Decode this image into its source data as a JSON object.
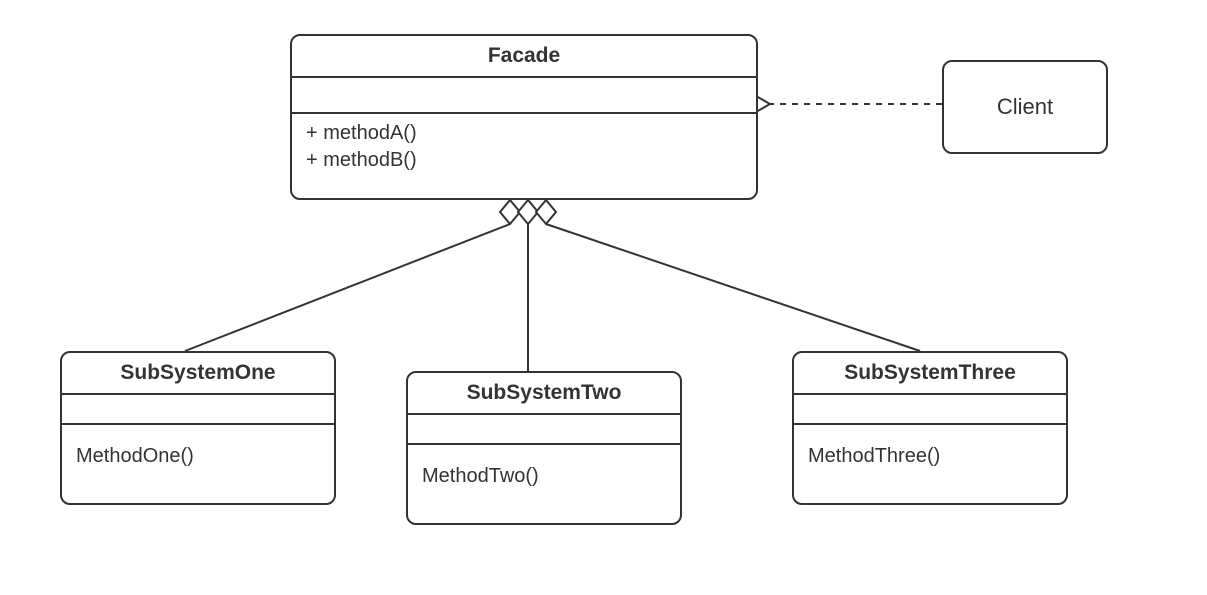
{
  "diagram": {
    "type": "uml-class-diagram",
    "pattern": "Facade",
    "facade": {
      "name": "Facade",
      "methods": [
        "+ methodA()",
        "+ methodB()"
      ]
    },
    "client": {
      "name": "Client"
    },
    "subsystems": [
      {
        "name": "SubSystemOne",
        "methods": [
          "MethodOne()"
        ]
      },
      {
        "name": "SubSystemTwo",
        "methods": [
          "MethodTwo()"
        ]
      },
      {
        "name": "SubSystemThree",
        "methods": [
          "MethodThree()"
        ]
      }
    ],
    "relationships": [
      {
        "from": "Client",
        "to": "Facade",
        "kind": "dependency"
      },
      {
        "from": "Facade",
        "to": "SubSystemOne",
        "kind": "aggregation"
      },
      {
        "from": "Facade",
        "to": "SubSystemTwo",
        "kind": "aggregation"
      },
      {
        "from": "Facade",
        "to": "SubSystemThree",
        "kind": "aggregation"
      }
    ]
  }
}
